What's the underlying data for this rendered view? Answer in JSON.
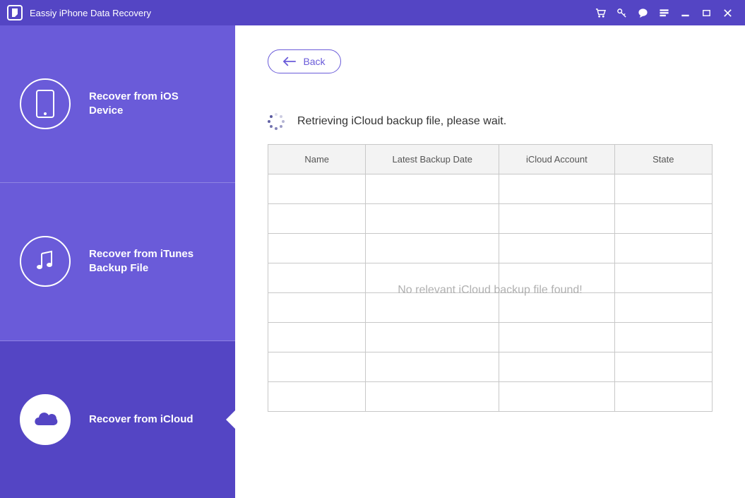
{
  "app": {
    "title": "Eassiy iPhone Data Recovery"
  },
  "sidebar": {
    "items": [
      {
        "label": "Recover from iOS Device"
      },
      {
        "label": "Recover from iTunes Backup File"
      },
      {
        "label": "Recover from iCloud"
      }
    ]
  },
  "main": {
    "back_label": "Back",
    "status_text": "Retrieving iCloud backup file, please wait.",
    "table": {
      "headers": {
        "name": "Name",
        "date": "Latest Backup Date",
        "account": "iCloud Account",
        "state": "State"
      },
      "empty_message": "No relevant iCloud backup file found!"
    }
  }
}
